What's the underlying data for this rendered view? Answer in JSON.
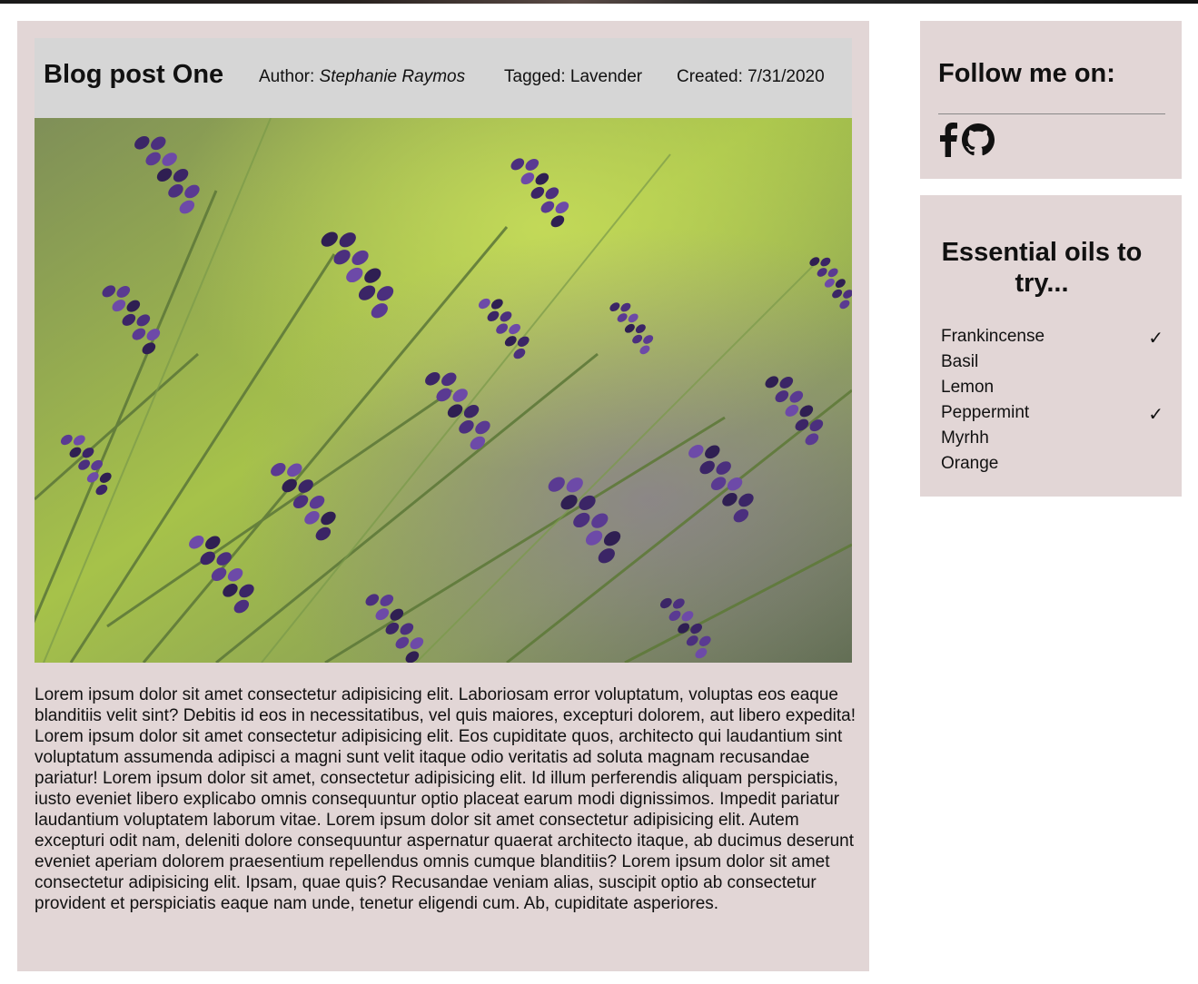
{
  "post": {
    "title": "Blog post One",
    "author_label": "Author: ",
    "author_name": "Stephanie Raymos",
    "tagged": "Tagged: Lavender",
    "created": "Created: 7/31/2020",
    "image_subject": "lavender flowers photo",
    "body": "Lorem ipsum dolor sit amet consectetur adipisicing elit. Laboriosam error voluptatum, voluptas eos eaque blanditiis velit sint? Debitis id eos in necessitatibus, vel quis maiores, excepturi dolorem, aut libero expedita! Lorem ipsum dolor sit amet consectetur adipisicing elit. Eos cupiditate quos, architecto qui laudantium sint voluptatum assumenda adipisci a magni sunt velit itaque odio veritatis ad soluta magnam recusandae pariatur! Lorem ipsum dolor sit amet, consectetur adipisicing elit. Id illum perferendis aliquam perspiciatis, iusto eveniet libero explicabo omnis consequuntur optio placeat earum modi dignissimos. Impedit pariatur laudantium voluptatem laborum vitae. Lorem ipsum dolor sit amet consectetur adipisicing elit. Autem excepturi odit nam, deleniti dolore consequuntur aspernatur quaerat architecto itaque, ab ducimus deserunt eveniet aperiam dolorem praesentium repellendus omnis cumque blanditiis? Lorem ipsum dolor sit amet consectetur adipisicing elit. Ipsam, quae quis? Recusandae veniam alias, suscipit optio ab consectetur provident et perspiciatis eaque nam unde, tenetur eligendi cum. Ab, cupiditate asperiores."
  },
  "follow": {
    "title": "Follow me on:",
    "icons": [
      "facebook-icon",
      "github-icon"
    ]
  },
  "oils": {
    "title": "Essential oils to try...",
    "items": [
      {
        "name": "Frankincense",
        "check": "✓"
      },
      {
        "name": "Basil",
        "check": ""
      },
      {
        "name": "Lemon",
        "check": ""
      },
      {
        "name": "Peppermint",
        "check": "✓"
      },
      {
        "name": "Myrhh",
        "check": ""
      },
      {
        "name": "Orange",
        "check": ""
      }
    ]
  },
  "colors": {
    "panel": "#e2d6d6",
    "header": "#d6d6d6",
    "lavender": "#4b2f7e",
    "foliage": "#9dbb3f"
  }
}
